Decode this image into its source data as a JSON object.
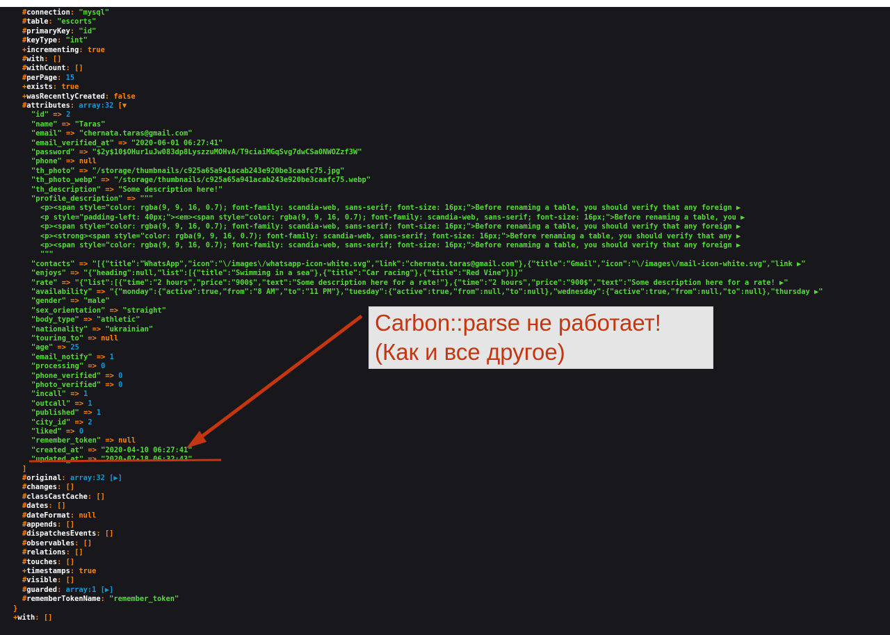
{
  "model": {
    "top_props": [
      {
        "mod": "#",
        "key": "connection",
        "val": "\"mysql\"",
        "type": "s"
      },
      {
        "mod": "#",
        "key": "table",
        "val": "\"escorts\"",
        "type": "s"
      },
      {
        "mod": "#",
        "key": "primaryKey",
        "val": "\"id\"",
        "type": "s"
      },
      {
        "mod": "#",
        "key": "keyType",
        "val": "\"int\"",
        "type": "s"
      },
      {
        "mod": "+",
        "key": "incrementing",
        "val": "true",
        "type": "c"
      },
      {
        "mod": "#",
        "key": "with",
        "val": "[]",
        "type": "p"
      },
      {
        "mod": "#",
        "key": "withCount",
        "val": "[]",
        "type": "p"
      },
      {
        "mod": "#",
        "key": "perPage",
        "val": "15",
        "type": "n"
      },
      {
        "mod": "+",
        "key": "exists",
        "val": "true",
        "type": "c"
      },
      {
        "mod": "+",
        "key": "wasRecentlyCreated",
        "val": "false",
        "type": "c"
      }
    ],
    "attributes_header": {
      "mod": "#",
      "key": "attributes",
      "note": "array:32",
      "open": "[▼"
    },
    "attributes": [
      {
        "key": "\"id\"",
        "val": "2",
        "type": "n"
      },
      {
        "key": "\"name\"",
        "val": "\"Taras\"",
        "type": "s"
      },
      {
        "key": "\"email\"",
        "val": "\"chernata.taras@gmail.com\"",
        "type": "s"
      },
      {
        "key": "\"email_verified_at\"",
        "val": "\"2020-06-01 06:27:41\"",
        "type": "s"
      },
      {
        "key": "\"password\"",
        "val": "\"$2y$10$OHur1uJw083dp8LyszzuMOHvA/T9ciaiMGqSvg7dwCSa0NWOZzf3W\"",
        "type": "s"
      },
      {
        "key": "\"phone\"",
        "val": "null",
        "type": "c"
      },
      {
        "key": "\"th_photo\"",
        "val": "\"/storage/thumbnails/c925a65a941acab243e920be3caafc75.jpg\"",
        "type": "s"
      },
      {
        "key": "\"th_photo_webp\"",
        "val": "\"/storage/thumbnails/c925a65a941acab243e920be3caafc75.webp\"",
        "type": "s"
      },
      {
        "key": "\"th_description\"",
        "val": "\"Some description here!\"",
        "type": "s"
      },
      {
        "key": "\"profile_description\"",
        "val": "\"\"\"",
        "type": "s"
      }
    ],
    "profile_lines": [
      "<p><span style=\"color: rgba(9, 9, 16, 0.7); font-family: scandia-web, sans-serif; font-size: 16px;\">Before renaming a table, you should verify that any foreign ▶",
      "<p style=\"padding-left: 40px;\"><em><span style=\"color: rgba(9, 9, 16, 0.7); font-family: scandia-web, sans-serif; font-size: 16px;\">Before renaming a table, you ▶",
      "<p><span style=\"color: rgba(9, 9, 16, 0.7); font-family: scandia-web, sans-serif; font-size: 16px;\">Before renaming a table, you should verify that any foreign ▶",
      "<p><strong><span style=\"color: rgba(9, 9, 16, 0.7); font-family: scandia-web, sans-serif; font-size: 16px;\">Before renaming a table, you should verify that any ▶",
      "<p><span style=\"color: rgba(9, 9, 16, 0.7); font-family: scandia-web, sans-serif; font-size: 16px;\">Before renaming a table, you should verify that any foreign ▶"
    ],
    "profile_close": "\"\"\"",
    "attributes2": [
      {
        "key": "\"contacts\"",
        "val": "\"[{\"title\":\"WhatsApp\",\"icon\":\"\\/images\\/whatsapp-icon-white.svg\",\"link\":\"chernata.taras@gmail.com\"},{\"title\":\"Gmail\",\"icon\":\"\\/images\\/mail-icon-white.svg\",\"link ▶\"",
        "type": "s"
      },
      {
        "key": "\"enjoys\"",
        "val": "\"{\"heading\":null,\"list\":[{\"title\":\"Swimming in a sea\"},{\"title\":\"Car racing\"},{\"title\":\"Red Vine\"}]}\"",
        "type": "s"
      },
      {
        "key": "\"rate\"",
        "val": "\"{\"list\":[{\"time\":\"2 hours\",\"price\":\"900$\",\"text\":\"Some description here for a rate!\"},{\"time\":\"2 hours\",\"price\":\"900$\",\"text\":\"Some description here for a rate! ▶\"",
        "type": "s"
      },
      {
        "key": "\"availability\"",
        "val": "\"{\"monday\":{\"active\":true,\"from\":\"8 AM\",\"to\":\"11 PM\"},\"tuesday\":{\"active\":true,\"from\":null,\"to\":null},\"wednesday\":{\"active\":true,\"from\":null,\"to\":null},\"thursday ▶\"",
        "type": "s"
      },
      {
        "key": "\"gender\"",
        "val": "\"male\"",
        "type": "s"
      },
      {
        "key": "\"sex_orientation\"",
        "val": "\"straight\"",
        "type": "s"
      },
      {
        "key": "\"body_type\"",
        "val": "\"athletic\"",
        "type": "s"
      },
      {
        "key": "\"nationality\"",
        "val": "\"ukrainian\"",
        "type": "s"
      },
      {
        "key": "\"touring_to\"",
        "val": "null",
        "type": "c"
      },
      {
        "key": "\"age\"",
        "val": "25",
        "type": "n"
      },
      {
        "key": "\"email_notify\"",
        "val": "1",
        "type": "n"
      },
      {
        "key": "\"processing\"",
        "val": "0",
        "type": "n"
      },
      {
        "key": "\"phone_verified\"",
        "val": "0",
        "type": "n"
      },
      {
        "key": "\"photo_verified\"",
        "val": "0",
        "type": "n"
      },
      {
        "key": "\"incall\"",
        "val": "1",
        "type": "n"
      },
      {
        "key": "\"outcall\"",
        "val": "1",
        "type": "n"
      },
      {
        "key": "\"published\"",
        "val": "1",
        "type": "n"
      },
      {
        "key": "\"city_id\"",
        "val": "2",
        "type": "n"
      },
      {
        "key": "\"liked\"",
        "val": "0",
        "type": "n"
      },
      {
        "key": "\"remember_token\"",
        "val": "null",
        "type": "c"
      },
      {
        "key": "\"created_at\"",
        "val": "\"2020-04-10 06:27:41\"",
        "type": "s"
      },
      {
        "key": "\"updated_at\"",
        "val": "\"2020-07-18 06:32:43\"",
        "type": "s"
      }
    ],
    "attributes_close": "]",
    "bottom_props": [
      {
        "mod": "#",
        "key": "original",
        "val": "array:32 [▶]",
        "type": "arr"
      },
      {
        "mod": "#",
        "key": "changes",
        "val": "[]",
        "type": "p"
      },
      {
        "mod": "#",
        "key": "classCastCache",
        "val": "[]",
        "type": "p"
      },
      {
        "mod": "#",
        "key": "dates",
        "val": "[]",
        "type": "p"
      },
      {
        "mod": "#",
        "key": "dateFormat",
        "val": "null",
        "type": "c"
      },
      {
        "mod": "#",
        "key": "appends",
        "val": "[]",
        "type": "p"
      },
      {
        "mod": "#",
        "key": "dispatchesEvents",
        "val": "[]",
        "type": "p"
      },
      {
        "mod": "#",
        "key": "observables",
        "val": "[]",
        "type": "p"
      },
      {
        "mod": "#",
        "key": "relations",
        "val": "[]",
        "type": "p"
      },
      {
        "mod": "#",
        "key": "touches",
        "val": "[]",
        "type": "p"
      },
      {
        "mod": "+",
        "key": "timestamps",
        "val": "true",
        "type": "c"
      },
      {
        "mod": "#",
        "key": "visible",
        "val": "[]",
        "type": "p"
      },
      {
        "mod": "#",
        "key": "guarded",
        "val": "array:1 [▶]",
        "type": "arr"
      },
      {
        "mod": "#",
        "key": "rememberTokenName",
        "val": "\"remember_token\"",
        "type": "s"
      }
    ],
    "close_brace": "}",
    "after": [
      {
        "mod": "+",
        "key": "with",
        "val": "[]",
        "type": "p"
      }
    ]
  },
  "annotation": {
    "line1": "Carbon::parse не работает!",
    "line2": "(Как и все другое)",
    "color": "#c4360f"
  }
}
